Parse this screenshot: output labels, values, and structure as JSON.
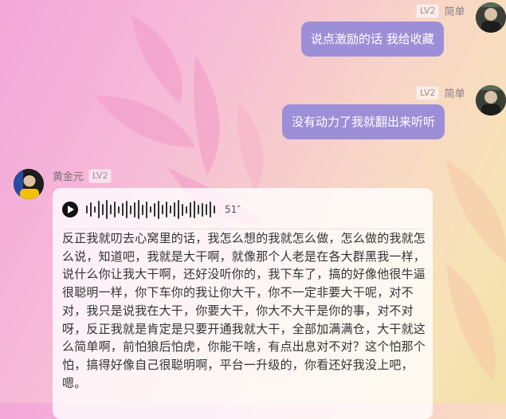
{
  "messages": [
    {
      "sender": "简单",
      "level": "LV2",
      "text": "说点激励的话 我给收藏"
    },
    {
      "sender": "简单",
      "level": "LV2",
      "text": "没有动力了我就翻出来听听"
    }
  ],
  "voice_message": {
    "sender": "黄金元",
    "level": "LV2",
    "duration": "51″",
    "transcript": "反正我就叨去心窝里的话，我怎么想的我就怎么做，怎么做的我就怎么说，知道吧，我就是大干啊，就像那个人老是在各大群黑我一样，说什么你让我大干啊，还好没听你的，我下车了，搞的好像他很牛逼很聪明一样，你下车你的我让你大干，你不一定非要大干呢，对不对，我只是说我在大干，你要大干，你大不大干是你的事，对不对呀，反正我就是肯定是只要开通我就大干，全部加满满仓，大干就这么简单啊，前怕狼后怕虎，你能干啥，有点出息对不对？这个怕那个怕，搞得好像自己很聪明啊，平台一升级的，你看还好我没上吧，嗯。"
  },
  "colors": {
    "bubble_right": "#9c8fd7",
    "card_bg": "#ffffff",
    "level_badge": "#9a8f95"
  }
}
